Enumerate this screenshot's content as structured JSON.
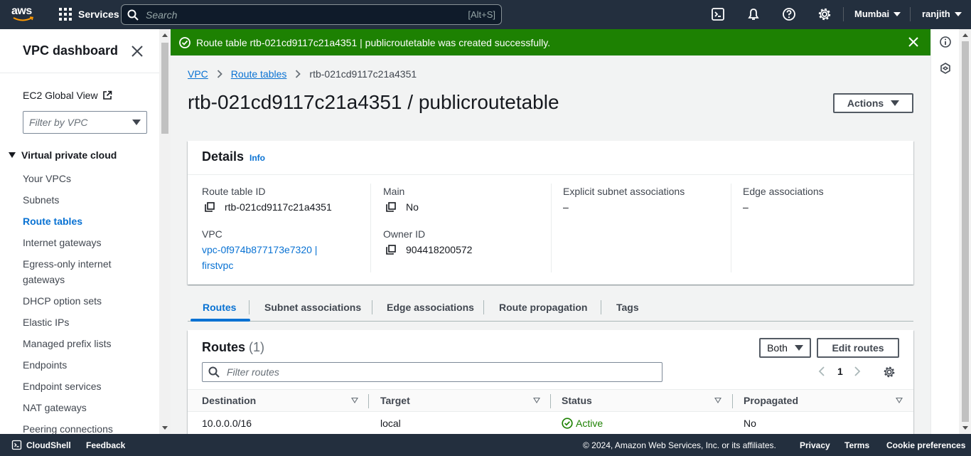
{
  "topnav": {
    "logo_text": "aws",
    "services_label": "Services",
    "search_placeholder": "Search",
    "search_shortcut": "[Alt+S]",
    "region": "Mumbai",
    "account": "ranjith"
  },
  "sidebar": {
    "title": "VPC dashboard",
    "ec2_global_view": "EC2 Global View",
    "filter_placeholder": "Filter by VPC",
    "section": "Virtual private cloud",
    "items": [
      {
        "label": "Your VPCs"
      },
      {
        "label": "Subnets"
      },
      {
        "label": "Route tables"
      },
      {
        "label": "Internet gateways"
      },
      {
        "label": "Egress-only internet gateways"
      },
      {
        "label": "DHCP option sets"
      },
      {
        "label": "Elastic IPs"
      },
      {
        "label": "Managed prefix lists"
      },
      {
        "label": "Endpoints"
      },
      {
        "label": "Endpoint services"
      },
      {
        "label": "NAT gateways"
      },
      {
        "label": "Peering connections"
      }
    ]
  },
  "flash": {
    "message": "Route table rtb-021cd9117c21a4351 | publicroutetable was created successfully.",
    "color": "#1d8102"
  },
  "breadcrumb": {
    "vpc": "VPC",
    "route_tables": "Route tables",
    "current": "rtb-021cd9117c21a4351"
  },
  "page": {
    "title": "rtb-021cd9117c21a4351 / publicroutetable",
    "actions_label": "Actions"
  },
  "details": {
    "title": "Details",
    "info": "Info",
    "route_table_id_label": "Route table ID",
    "route_table_id": "rtb-021cd9117c21a4351",
    "vpc_label": "VPC",
    "vpc_line1": "vpc-0f974b877173e7320 |",
    "vpc_line2": "firstvpc",
    "main_label": "Main",
    "main_value": "No",
    "owner_label": "Owner ID",
    "owner_value": "904418200572",
    "explicit_label": "Explicit subnet associations",
    "explicit_value": "–",
    "edge_label": "Edge associations",
    "edge_value": "–"
  },
  "tabs": [
    {
      "label": "Routes"
    },
    {
      "label": "Subnet associations"
    },
    {
      "label": "Edge associations"
    },
    {
      "label": "Route propagation"
    },
    {
      "label": "Tags"
    }
  ],
  "routes": {
    "title": "Routes",
    "count": "(1)",
    "both_label": "Both",
    "edit_label": "Edit routes",
    "filter_placeholder": "Filter routes",
    "page": "1",
    "columns": [
      "Destination",
      "Target",
      "Status",
      "Propagated"
    ],
    "rows": [
      {
        "destination": "10.0.0.0/16",
        "target": "local",
        "status": "Active",
        "propagated": "No"
      }
    ],
    "status_color": "#1d8102"
  },
  "footer": {
    "cloudshell": "CloudShell",
    "feedback": "Feedback",
    "copyright": "© 2024, Amazon Web Services, Inc. or its affiliates.",
    "privacy": "Privacy",
    "terms": "Terms",
    "cookies": "Cookie preferences"
  },
  "icons": [
    "grid-icon",
    "search-icon",
    "cloudshell-icon",
    "bell-icon",
    "help-icon",
    "gear-icon",
    "close-icon",
    "external-link-icon",
    "copy-icon",
    "check-circle-icon",
    "info-icon",
    "hexagon-icon"
  ]
}
